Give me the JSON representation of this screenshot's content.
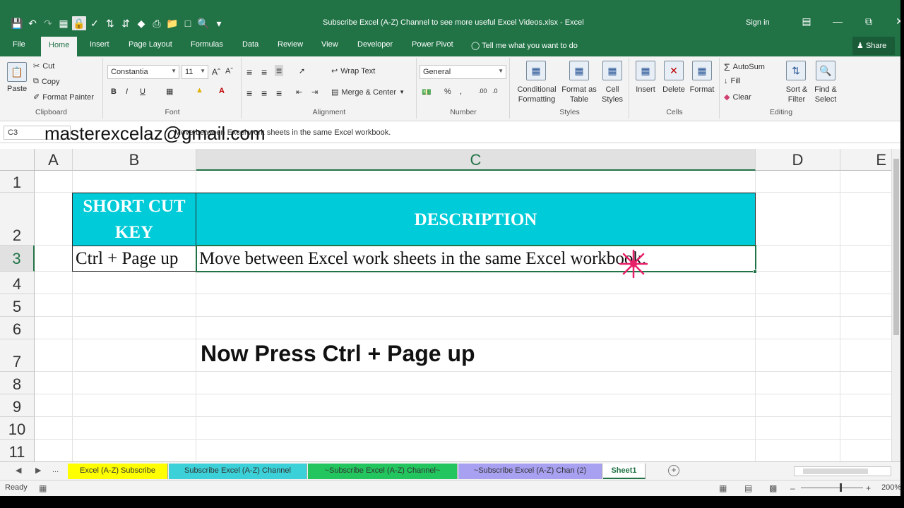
{
  "window": {
    "title": "Subscribe Excel (A-Z) Channel to see more useful Excel Videos.xlsx  -  Excel",
    "sign_in": "Sign in",
    "share": "Share",
    "tell_me": "Tell me what you want to do"
  },
  "tabs": [
    "File",
    "Home",
    "Insert",
    "Page Layout",
    "Formulas",
    "Data",
    "Review",
    "View",
    "Developer",
    "Power Pivot"
  ],
  "ribbon": {
    "clipboard": {
      "label": "Clipboard",
      "paste": "Paste",
      "cut": "Cut",
      "copy": "Copy",
      "format_painter": "Format Painter"
    },
    "font": {
      "label": "Font",
      "font_name": "Constantia",
      "font_size": "11"
    },
    "alignment": {
      "label": "Alignment",
      "wrap_text": "Wrap Text",
      "merge_center": "Merge & Center"
    },
    "number": {
      "label": "Number",
      "format": "General"
    },
    "styles": {
      "label": "Styles",
      "conditional_1": "Conditional",
      "conditional_2": "Formatting",
      "format_as_1": "Format as",
      "format_as_2": "Table",
      "cell_styles_1": "Cell",
      "cell_styles_2": "Styles"
    },
    "cells": {
      "label": "Cells",
      "insert": "Insert",
      "delete": "Delete",
      "format": "Format"
    },
    "editing": {
      "label": "Editing",
      "autosum": "AutoSum",
      "fill": "Fill",
      "clear": "Clear",
      "sort_1": "Sort &",
      "sort_2": "Filter",
      "find_1": "Find &",
      "find_2": "Select"
    }
  },
  "formula_bar": {
    "name_box": "C3",
    "formula": "Move between Excel work sheets in the same Excel workbook.",
    "overlay_email": "masterexcelaz@gmail.com"
  },
  "columns": [
    "A",
    "B",
    "C",
    "D",
    "E"
  ],
  "rows": [
    "1",
    "2",
    "3",
    "4",
    "5",
    "6",
    "7",
    "8",
    "9",
    "10",
    "11"
  ],
  "table": {
    "header_key_line1": "SHORT CUT",
    "header_key_line2": "KEY",
    "header_desc": "DESCRIPTION",
    "row_key": "Ctrl + Page up",
    "row_desc": "Move between Excel work sheets in the same Excel workbook."
  },
  "instruction": "Now Press Ctrl + Page up",
  "sheets": [
    {
      "name": "Excel (A-Z) Subscribe",
      "color": "#ffff00"
    },
    {
      "name": "Subscribe Excel (A-Z) Channel",
      "color": "#3cd1d8"
    },
    {
      "name": "~Subscribe Excel (A-Z) Channel~",
      "color": "#22c55e"
    },
    {
      "name": "~Subscribe Excel (A-Z) Chan (2)",
      "color": "#a8a0f0"
    },
    {
      "name": "Sheet1",
      "color": "#ffffff"
    }
  ],
  "sheet_nav_more": "...",
  "status": {
    "ready": "Ready",
    "zoom": "200%"
  },
  "colors": {
    "accent": "#217346",
    "header_fill": "#00cbd8",
    "cursor": "#e8206a"
  }
}
